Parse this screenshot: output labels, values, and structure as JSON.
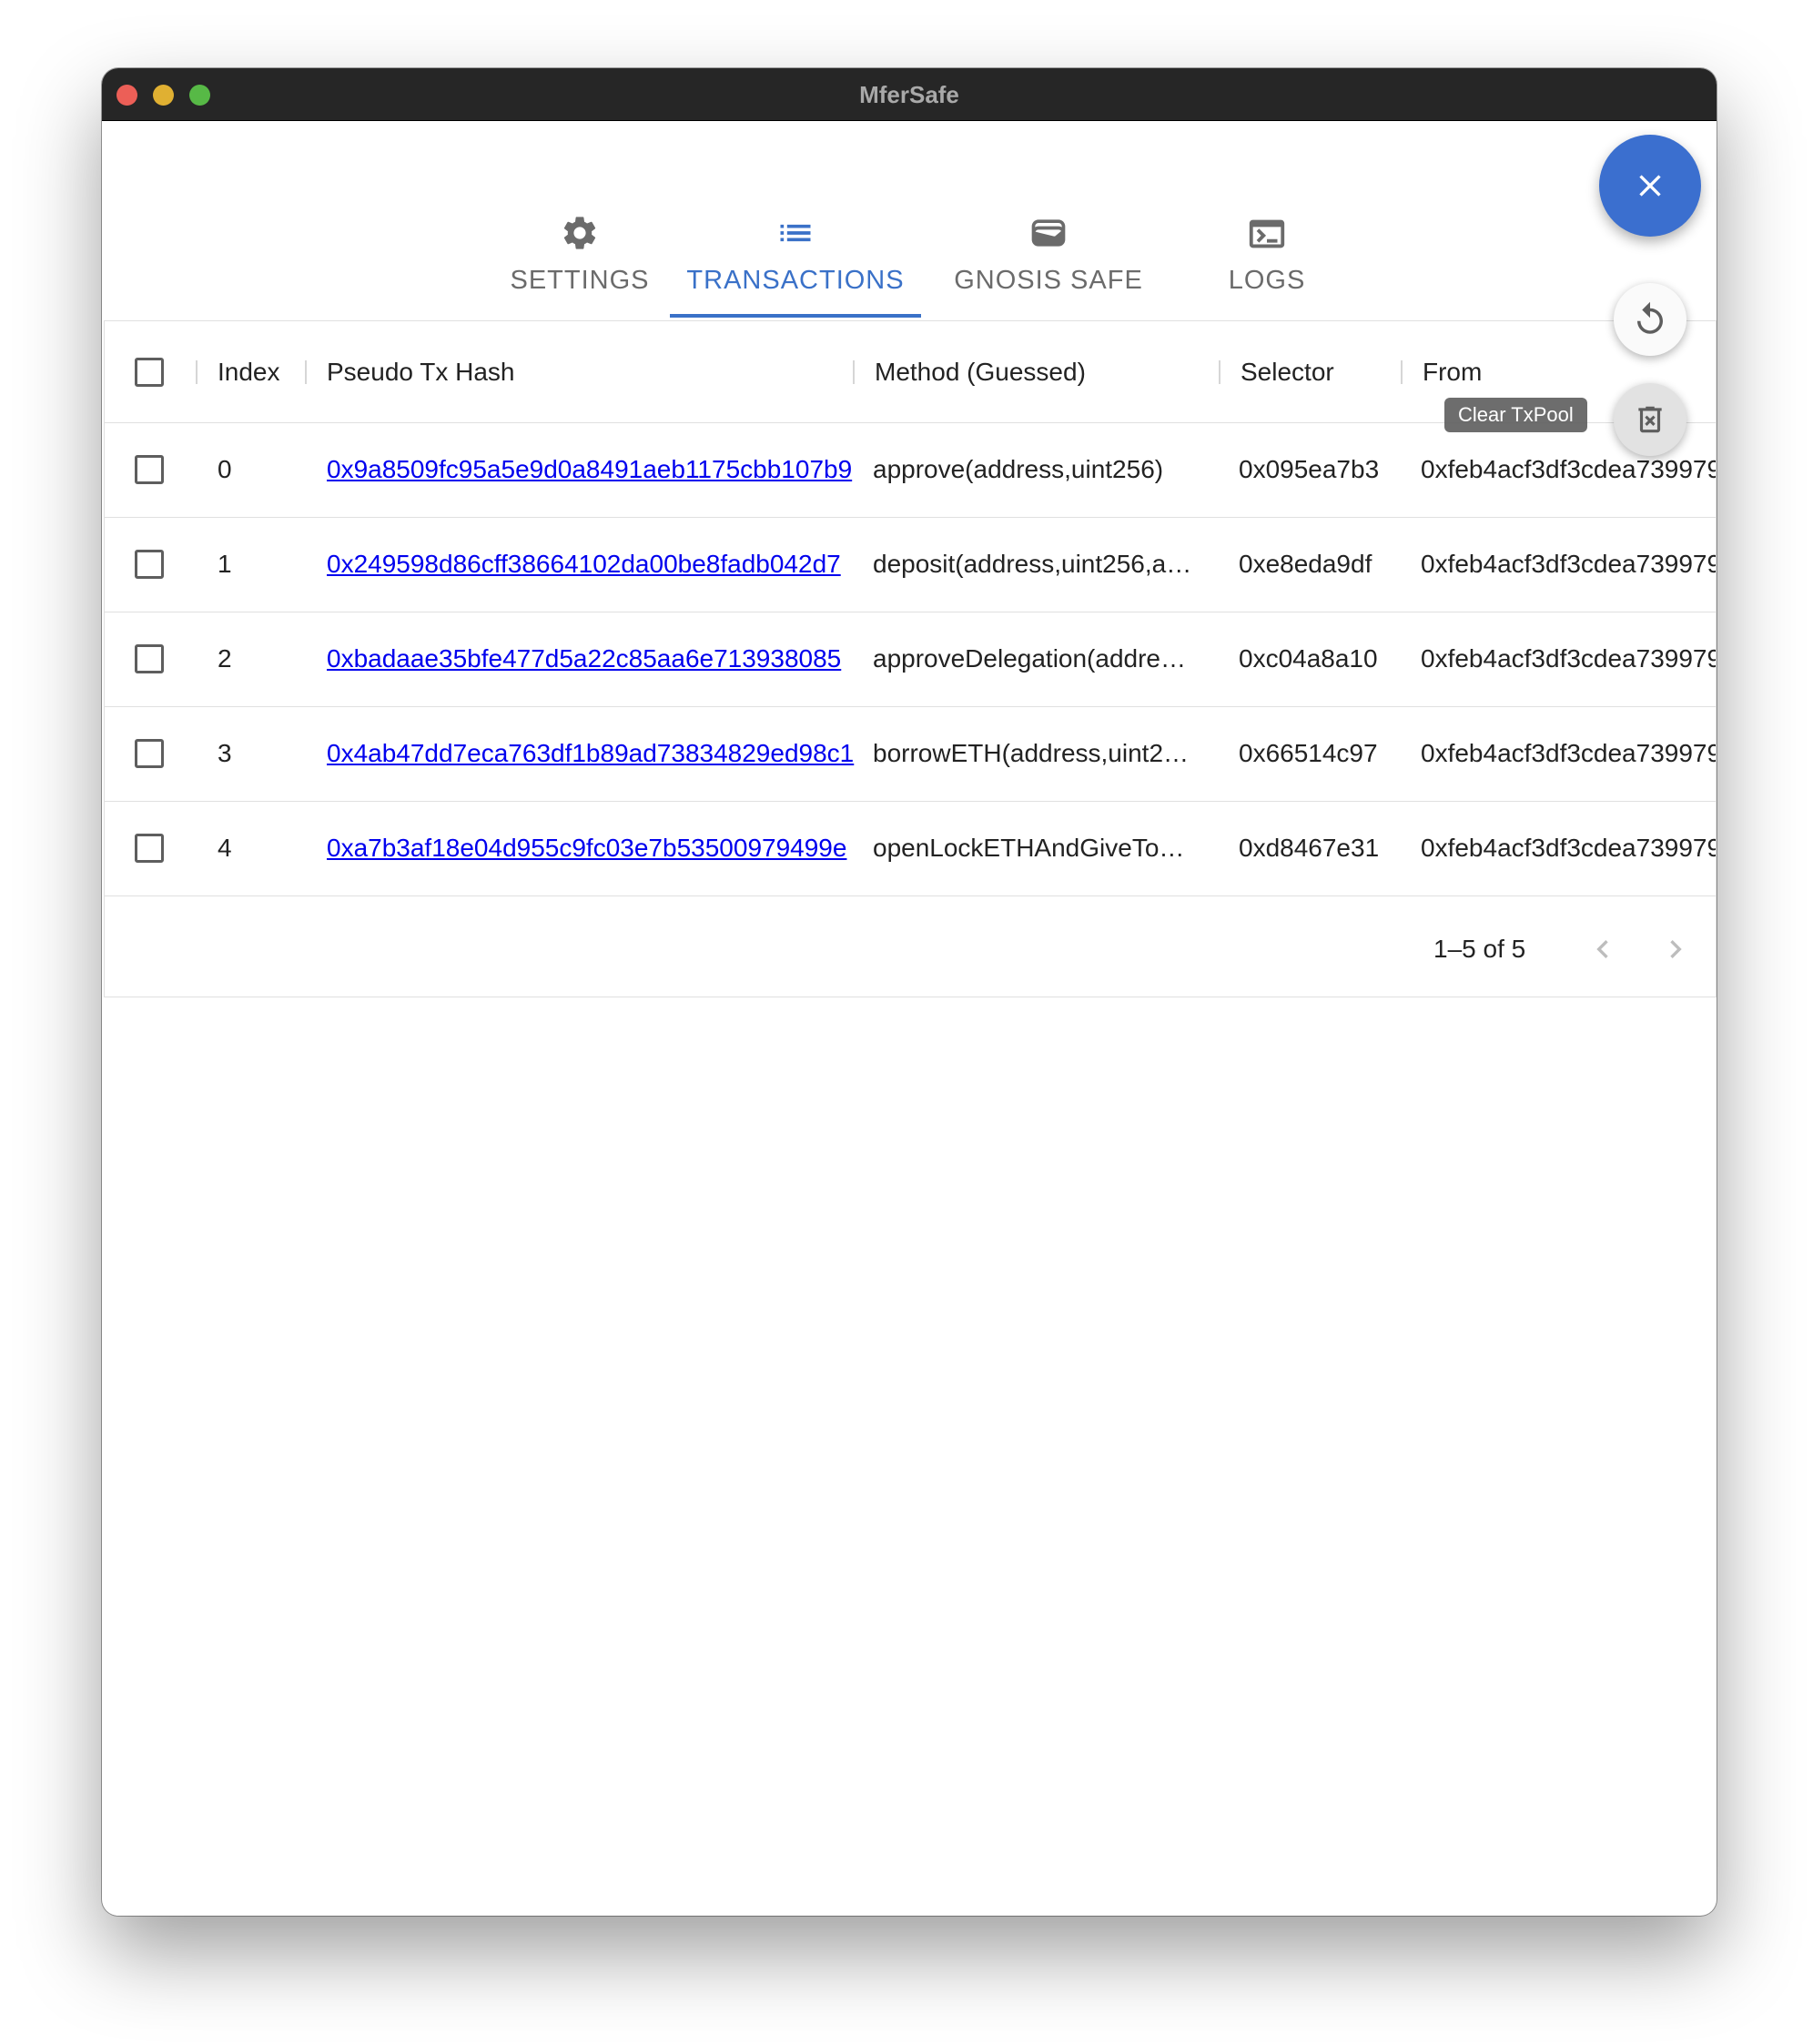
{
  "window": {
    "title": "MferSafe"
  },
  "tabs": [
    {
      "label": "SETTINGS",
      "icon": "gear-icon"
    },
    {
      "label": "TRANSACTIONS",
      "icon": "list-icon",
      "active": true
    },
    {
      "label": "GNOSIS SAFE",
      "icon": "wallet-icon"
    },
    {
      "label": "LOGS",
      "icon": "terminal-icon"
    }
  ],
  "actions": {
    "fab": {
      "icon": "close-icon"
    },
    "refresh": {
      "icon": "refresh-icon"
    },
    "clear": {
      "icon": "delete-icon",
      "tooltip": "Clear TxPool"
    }
  },
  "table": {
    "columns": [
      "Index",
      "Pseudo Tx Hash",
      "Method (Guessed)",
      "Selector",
      "From"
    ],
    "rows": [
      {
        "index": "0",
        "hash": "0x9a8509fc95a5e9d0a8491aeb1175cbb107b9",
        "method": "approve(address,uint256)",
        "selector": "0x095ea7b3",
        "from": "0xfeb4acf3df3cdea739979"
      },
      {
        "index": "1",
        "hash": "0x249598d86cff38664102da00be8fadb042d7",
        "method": "deposit(address,uint256,a…",
        "selector": "0xe8eda9df",
        "from": "0xfeb4acf3df3cdea739979"
      },
      {
        "index": "2",
        "hash": "0xbadaae35bfe477d5a22c85aa6e713938085",
        "method": "approveDelegation(addre…",
        "selector": "0xc04a8a10",
        "from": "0xfeb4acf3df3cdea739979"
      },
      {
        "index": "3",
        "hash": "0x4ab47dd7eca763df1b89ad73834829ed98c1",
        "method": "borrowETH(address,uint2…",
        "selector": "0x66514c97",
        "from": "0xfeb4acf3df3cdea739979"
      },
      {
        "index": "4",
        "hash": "0xa7b3af18e04d955c9fc03e7b53500979499e",
        "method": "openLockETHAndGiveTo…",
        "selector": "0xd8467e31",
        "from": "0xfeb4acf3df3cdea739979"
      }
    ],
    "pagination": "1–5 of 5"
  },
  "colors": {
    "accent": "#3a71c8",
    "fab": "#3b6fcf",
    "link": "#0000ee"
  }
}
